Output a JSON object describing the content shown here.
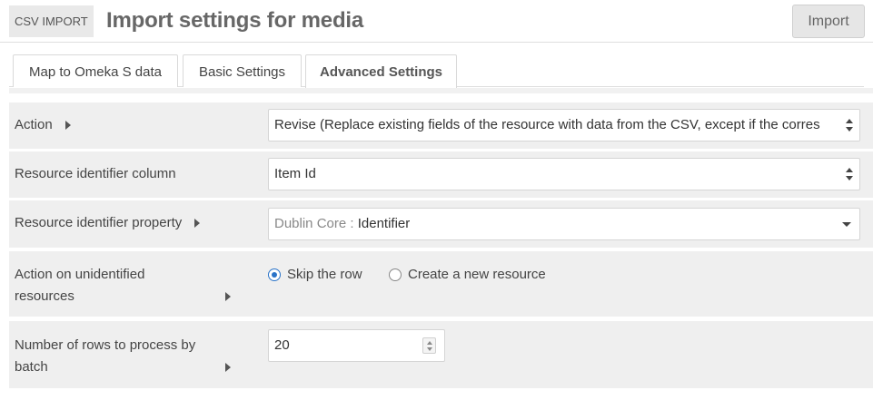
{
  "header": {
    "module_badge": "CSV IMPORT",
    "title": "Import settings for media",
    "import_button": "Import"
  },
  "tabs": [
    {
      "label": "Map to Omeka S data",
      "active": false
    },
    {
      "label": "Basic Settings",
      "active": false
    },
    {
      "label": "Advanced Settings",
      "active": true
    }
  ],
  "fields": {
    "action": {
      "label": "Action",
      "value": "Revise (Replace existing fields of the resource with data from the CSV, except if the corres"
    },
    "identifier_column": {
      "label": "Resource identifier column",
      "value": "Item Id"
    },
    "identifier_property": {
      "label": "Resource identifier property",
      "vocabulary": "Dublin Core",
      "separator": " : ",
      "property": "Identifier"
    },
    "unidentified": {
      "label_line1": "Action on unidentified",
      "label_line2": "resources",
      "options": [
        {
          "label": "Skip the row",
          "checked": true
        },
        {
          "label": "Create a new resource",
          "checked": false
        }
      ]
    },
    "rows_per_batch": {
      "label_line1": "Number of rows to process by",
      "label_line2": "batch",
      "value": "20"
    }
  },
  "icons": {
    "info_caret": "caret-right-icon",
    "select_arrows": "select-updown-icon",
    "dropdown": "chevron-down-icon",
    "number_spinner": "spinner-icon"
  },
  "colors": {
    "radio_accent": "#2a73c8",
    "row_background": "#efefef",
    "title_text": "#676767"
  }
}
